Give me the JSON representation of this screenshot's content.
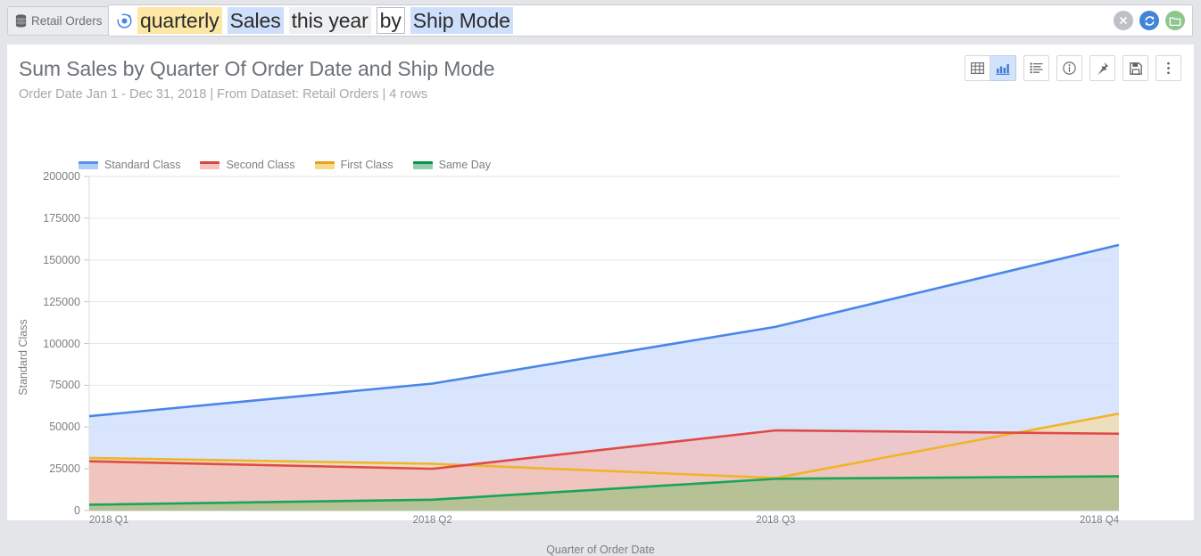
{
  "topbar": {
    "dataset_tab": {
      "label": "Retail Orders",
      "icon": "database-icon"
    },
    "search": {
      "icon": "magic-search-icon",
      "tokens": [
        {
          "text": "quarterly",
          "style": "yellow"
        },
        {
          "text": "Sales",
          "style": "blue"
        },
        {
          "text": "this year",
          "style": "grey"
        },
        {
          "text": "by",
          "style": "boxed"
        },
        {
          "text": "Ship Mode",
          "style": "blue"
        }
      ],
      "actions": [
        {
          "name": "clear-search-button",
          "icon": "close-icon",
          "color": "#bdc1c6"
        },
        {
          "name": "refresh-button",
          "icon": "refresh-icon",
          "color": "#4285d6"
        },
        {
          "name": "open-folder-button",
          "icon": "folder-icon",
          "color": "#8ec78e"
        }
      ]
    }
  },
  "card": {
    "title": "Sum Sales by Quarter Of Order Date and Ship Mode",
    "subtitle": "Order Date Jan 1 - Dec 31, 2018 | From Dataset: Retail Orders | 4 rows",
    "toolbar": [
      {
        "name": "table-view-button",
        "icon": "table-icon",
        "active": false
      },
      {
        "name": "chart-view-button",
        "icon": "bar-chart-icon",
        "active": true
      },
      {
        "name": "column-list-button",
        "icon": "list-icon",
        "active": false
      },
      {
        "name": "info-button",
        "icon": "info-icon",
        "active": false
      },
      {
        "name": "pin-button",
        "icon": "pin-icon",
        "active": false
      },
      {
        "name": "save-button",
        "icon": "save-icon",
        "active": false
      },
      {
        "name": "more-options-button",
        "icon": "kebab-menu-icon",
        "active": false
      }
    ]
  },
  "chart_data": {
    "type": "area",
    "title": "Sum Sales by Quarter Of Order Date and Ship Mode",
    "xlabel": "Quarter of Order Date",
    "ylabel": "Standard Class",
    "categories": [
      "2018 Q1",
      "2018 Q2",
      "2018 Q3",
      "2018 Q4"
    ],
    "ylim": [
      0,
      200000
    ],
    "yticks": [
      0,
      25000,
      50000,
      75000,
      100000,
      125000,
      150000,
      175000,
      200000
    ],
    "grid": true,
    "legend_position": "top-left",
    "series": [
      {
        "name": "Standard Class",
        "color": "#4a86e8",
        "fill": "#cfdffb",
        "values": [
          56500,
          76000,
          110000,
          159000
        ]
      },
      {
        "name": "Second Class",
        "color": "#e04a45",
        "fill": "#f0c0c0",
        "values": [
          29500,
          25000,
          48000,
          46000
        ]
      },
      {
        "name": "First Class",
        "color": "#f0b429",
        "fill": "#f2dcb0",
        "values": [
          31500,
          28000,
          19500,
          58000
        ]
      },
      {
        "name": "Same Day",
        "color": "#18a558",
        "fill": "#a8bf8c",
        "values": [
          3500,
          6500,
          19000,
          20500
        ]
      }
    ]
  }
}
